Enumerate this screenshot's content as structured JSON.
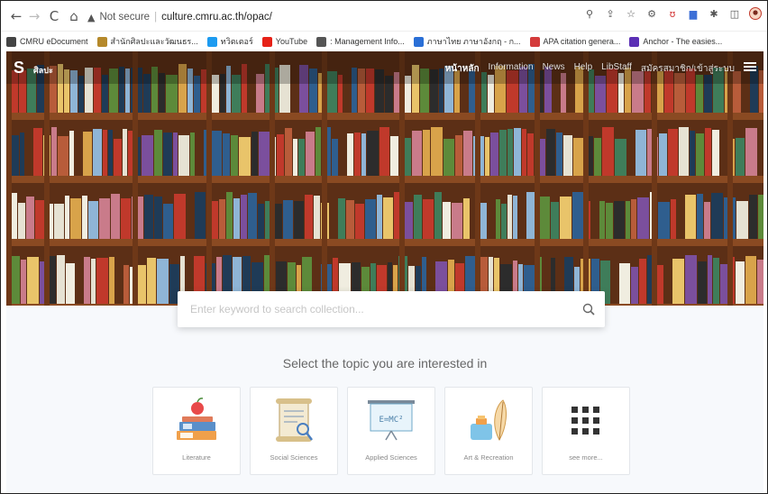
{
  "browser": {
    "nav": {
      "back_icon": "arrow-left-icon",
      "forward_icon": "arrow-right-icon",
      "reload_icon": "reload-icon",
      "home_icon": "home-icon"
    },
    "security_label": "Not secure",
    "url": "culture.cmru.ac.th/opac/",
    "bookmarks": [
      {
        "label": "CMRU eDocument",
        "color": "#444444"
      },
      {
        "label": "สำนักศิลปะและวัฒนธร...",
        "color": "#b5892b"
      },
      {
        "label": "ทวิตเตอร์",
        "color": "#1d9bf0"
      },
      {
        "label": "YouTube",
        "color": "#e62117"
      },
      {
        "label": ": Management Info...",
        "color": "#555555"
      },
      {
        "label": "ภาษาไทย ภาษาอังกฤ - ก...",
        "color": "#2a6fd6"
      },
      {
        "label": "APA citation genera...",
        "color": "#d43b3b"
      },
      {
        "label": "Anchor - The easies...",
        "color": "#5b2fb5"
      }
    ]
  },
  "site": {
    "logo_letter": "S",
    "logo_text": "ศิลปะ",
    "menu": [
      {
        "label": "หน้าหลัก",
        "active": true
      },
      {
        "label": "Information",
        "active": false
      },
      {
        "label": "News",
        "active": false
      },
      {
        "label": "Help",
        "active": false
      },
      {
        "label": "LibStaff",
        "active": false
      },
      {
        "label": "สมัครสมาชิก/เข้าสู่ระบบ",
        "active": false
      }
    ]
  },
  "search": {
    "placeholder": "Enter keyword to search collection..."
  },
  "topics": {
    "title": "Select the topic you are interested in",
    "items": [
      {
        "label": "Literature",
        "icon": "books-apple-icon"
      },
      {
        "label": "Social Sciences",
        "icon": "scroll-document-icon"
      },
      {
        "label": "Applied Sciences",
        "icon": "whiteboard-emc2-icon"
      },
      {
        "label": "Art & Recreation",
        "icon": "ink-feather-icon"
      },
      {
        "label": "see more...",
        "icon": "grid-dots-icon"
      }
    ]
  },
  "colors": {
    "accent": "#f08a3c",
    "wood": "#7a4422"
  }
}
